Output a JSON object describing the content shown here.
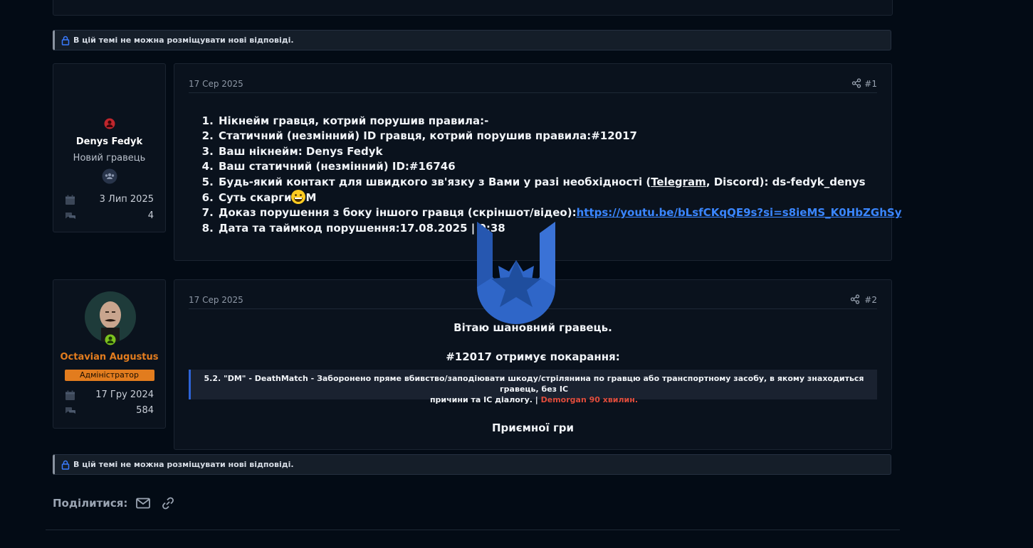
{
  "notice_text": "В цій темі не можна розміщувати нові відповіді.",
  "post1": {
    "author": {
      "name": "Denys Fedyk",
      "title": "Новий гравець",
      "joined": "3 Лип 2025",
      "messages": "4"
    },
    "date": "17 Сер 2025",
    "number": "#1",
    "items": [
      {
        "label": "Нікнейм гравця, котрий порушив правила:-"
      },
      {
        "label": "Статичний (незмінний) ID гравця, котрий порушив правила:#12017"
      },
      {
        "label": "Ваш нікнейм: Denys Fedyk"
      },
      {
        "label": "Ваш статичний (незмінний) ID:#16746"
      },
      {
        "pre": "Будь-який контакт для швидкого зв'язку з Вами у разі необхідності (",
        "link": "Telegram",
        "post": ", Discord): ds-fedyk_denys"
      },
      {
        "pre": "Суть скарги",
        "post": "M"
      },
      {
        "pre": "Доказ порушення з боку іншого гравця (скріншот/відео):",
        "link": "https://youtu.be/bLsfCKqQE9s?si=s8ieMS_K0HbZGhSy"
      },
      {
        "label": "Дата та таймкод порушення:17.08.2025 | 0:38"
      }
    ]
  },
  "post2": {
    "author": {
      "name": "Octavian Augustus",
      "role": "Адміністратор",
      "joined": "17 Гру 2024",
      "messages": "584"
    },
    "date": "17 Сер 2025",
    "number": "#2",
    "greeting": "Вітаю шановний гравець.",
    "punishment": "#12017 отримує покарання:",
    "quote_line1": "5.2. \"DM\" - DeathMatch - Заборонено пряме вбивство/заподіювати шкоду/стрілянина по гравцю або транспортному засобу, в якому знаходиться гравець, без IC",
    "quote_line2": "причини та IC діалогу. | ",
    "quote_red": "Demorgan 90 хвилин.",
    "closing": "Приємної гри"
  },
  "share_label": "Поділитися:",
  "colors": {
    "accent": "#2d63d6",
    "admin_badge": "#e27c1e",
    "offline": "#c0262d",
    "online": "#7cc21e",
    "link": "#3a86ff"
  },
  "icons": [
    "lock-icon",
    "share-icon",
    "calendar-icon",
    "messages-icon",
    "group-icon",
    "envelope-icon",
    "link-icon",
    "emoji-icon",
    "watermark-logo"
  ]
}
